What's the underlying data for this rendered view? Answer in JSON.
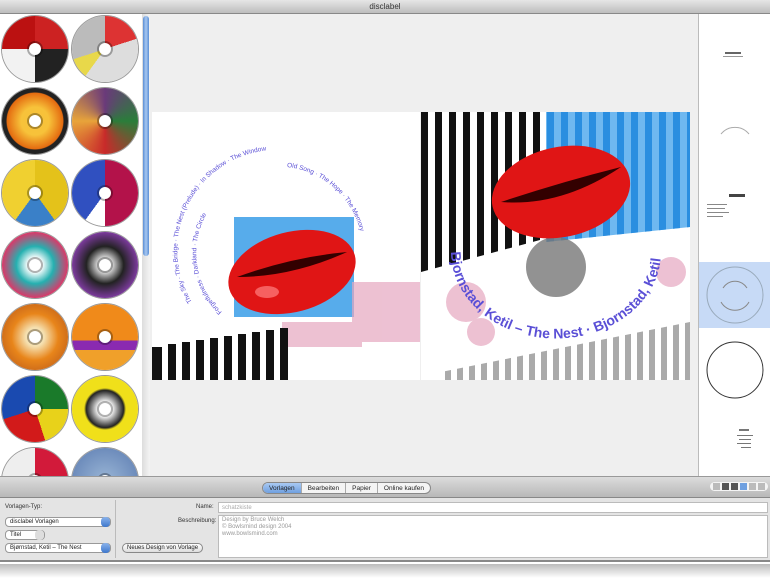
{
  "window": {
    "title": "disclabel"
  },
  "toolbar": {
    "tabs": [
      {
        "label": "Vorlagen",
        "selected": true
      },
      {
        "label": "Bearbeiten"
      },
      {
        "label": "Papier"
      },
      {
        "label": "Online kaufen"
      }
    ]
  },
  "panel": {
    "template_type_label": "Vorlagen-Typ:",
    "template_type_value": "disclabel Vorlagen",
    "title_label": "Titel",
    "template_value": "Bjørnstad, Ketil – The Nest",
    "new_design_button": "Neues Design von Vorlage",
    "name_label": "Name:",
    "name_value": "schatzkiste",
    "description_label": "Beschreibung:",
    "description_lines": [
      "Design by Bruce Welch",
      "© Bowlsmind design 2004",
      "www.bowlsmind.com"
    ]
  },
  "canvas": {
    "left_label_tracks": "The Sky · The Bridge · The Nest (Prelude) · In Shadow · The Window",
    "left_label_tracks2": "Forgetfulness · Darkland · The Circle",
    "left_label_inner": "Old Song · The Hope · The Memory",
    "right_label_text": "Bjornstad, Ketil – The Nest · Bjornstad, Ketil"
  },
  "colors": {
    "accent": "#6fa0e0",
    "text_blue": "#5a4fd6",
    "lips": "#e01515"
  }
}
